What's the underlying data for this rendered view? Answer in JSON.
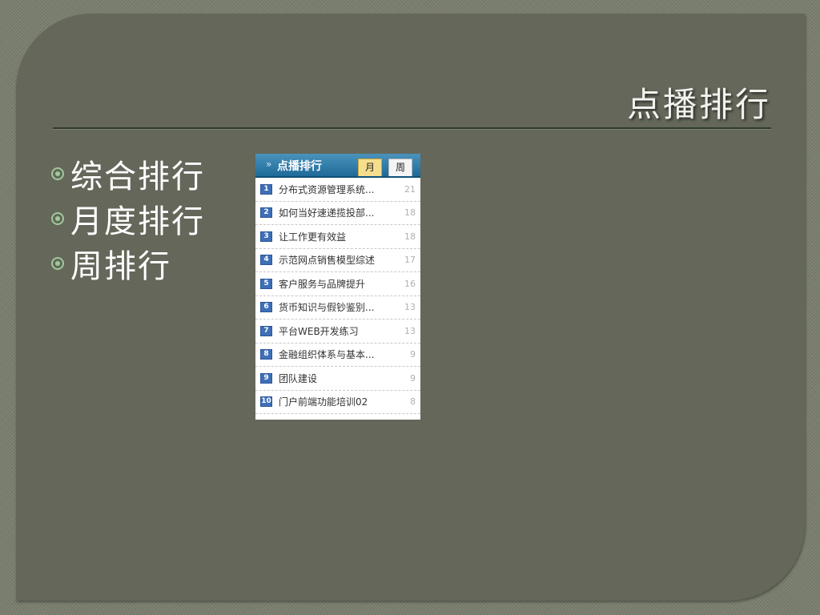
{
  "slide": {
    "title": "点播排行",
    "bullets": [
      {
        "text": "综合排行"
      },
      {
        "text": "月度排行"
      },
      {
        "text": "周排行"
      }
    ]
  },
  "panel": {
    "arrow": "»",
    "title": "点播排行",
    "tabs": [
      {
        "label": "月",
        "selected": true
      },
      {
        "label": "周",
        "selected": false
      }
    ],
    "items": [
      {
        "rank": "1",
        "title": "分布式资源管理系统...",
        "count": "21"
      },
      {
        "rank": "2",
        "title": "如何当好速递揽投部...",
        "count": "18"
      },
      {
        "rank": "3",
        "title": "让工作更有效益",
        "count": "18"
      },
      {
        "rank": "4",
        "title": "示范网点销售模型综述",
        "count": "17"
      },
      {
        "rank": "5",
        "title": "客户服务与品牌提升",
        "count": "16"
      },
      {
        "rank": "6",
        "title": "货币知识与假钞鉴别...",
        "count": "13"
      },
      {
        "rank": "7",
        "title": "平台WEB开发练习",
        "count": "13"
      },
      {
        "rank": "8",
        "title": "金融组织体系与基本...",
        "count": "9"
      },
      {
        "rank": "9",
        "title": "团队建设",
        "count": "9"
      },
      {
        "rank": "10",
        "title": "门户前端功能培训02",
        "count": "8"
      }
    ]
  },
  "colors": {
    "background": "#7a7e6e",
    "slide": "#64675a",
    "bullet_accent": "#9ec99a",
    "panel_header": "#1f6a98",
    "tab_selected": "#f6df8c",
    "rank_badge": "#3e6fb8"
  },
  "icons": {
    "bullet": "circle-bullet-icon",
    "header_arrow": "double-chevron-right-icon"
  }
}
